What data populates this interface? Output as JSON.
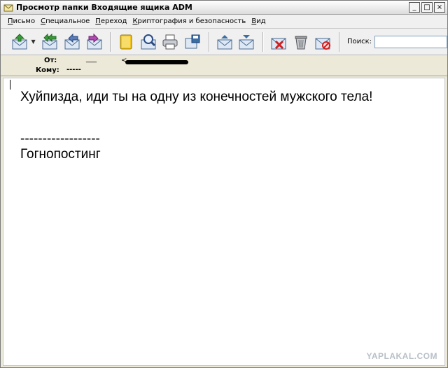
{
  "window": {
    "title": "Просмотр папки Входящие ящика ADM",
    "buttons": {
      "minimize": "_",
      "maximize": "□",
      "close": "×"
    }
  },
  "menu": [
    "Письмо",
    "Специальное",
    "Переход",
    "Криптография и безопасность",
    "Вид"
  ],
  "toolbar": {
    "buttons": [
      {
        "icon": "receive-mail-icon"
      },
      {
        "icon": "reply-all-icon"
      },
      {
        "icon": "reply-icon"
      },
      {
        "icon": "forward-icon"
      },
      {
        "icon": "address-book-icon"
      },
      {
        "icon": "find-icon"
      },
      {
        "icon": "print-icon"
      },
      {
        "icon": "save-icon"
      },
      {
        "icon": "previous-message-icon"
      },
      {
        "icon": "next-message-icon"
      },
      {
        "icon": "delete-icon"
      },
      {
        "icon": "trash-icon"
      },
      {
        "icon": "mark-spam-icon"
      }
    ],
    "search_label": "Поиск:",
    "search_value": ""
  },
  "headers": {
    "from_label": "От:",
    "from_value": "___",
    "from_bracket": "<",
    "to_label": "Кому:",
    "to_value": "-----"
  },
  "message": {
    "lines": [
      "Хуйпизда, иди ты на одну из конечностей мужского тела!",
      "",
      "------------------",
      "Гогнопостинг"
    ]
  },
  "watermark": "YAPLAKAL.COM",
  "colors": {
    "window_bg": "#ece9d8",
    "toolbar_bg": "#f0f0f0",
    "body_bg": "#ffffff",
    "accent_blue": "#3a6ea5",
    "accent_green": "#3a9a3a"
  }
}
